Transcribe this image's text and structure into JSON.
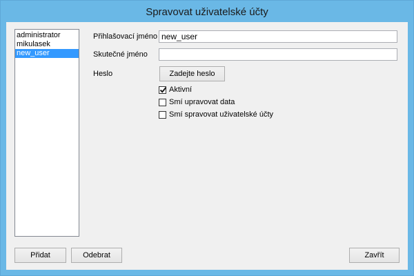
{
  "window": {
    "title": "Spravovat uživatelské účty"
  },
  "users": [
    "administrator",
    "mikulasek",
    "new_user"
  ],
  "selected_user_index": 2,
  "form": {
    "login_label": "Přihlašovací jméno",
    "login_value": "new_user",
    "realname_label": "Skutečné jméno",
    "realname_value": "",
    "password_label": "Heslo",
    "password_button": "Zadejte heslo",
    "checkboxes": [
      {
        "label": "Aktivní",
        "checked": true
      },
      {
        "label": "Smí upravovat data",
        "checked": false
      },
      {
        "label": "Smí spravovat uživatelské účty",
        "checked": false
      }
    ]
  },
  "buttons": {
    "add": "Přidat",
    "remove": "Odebrat",
    "close": "Zavřít"
  }
}
